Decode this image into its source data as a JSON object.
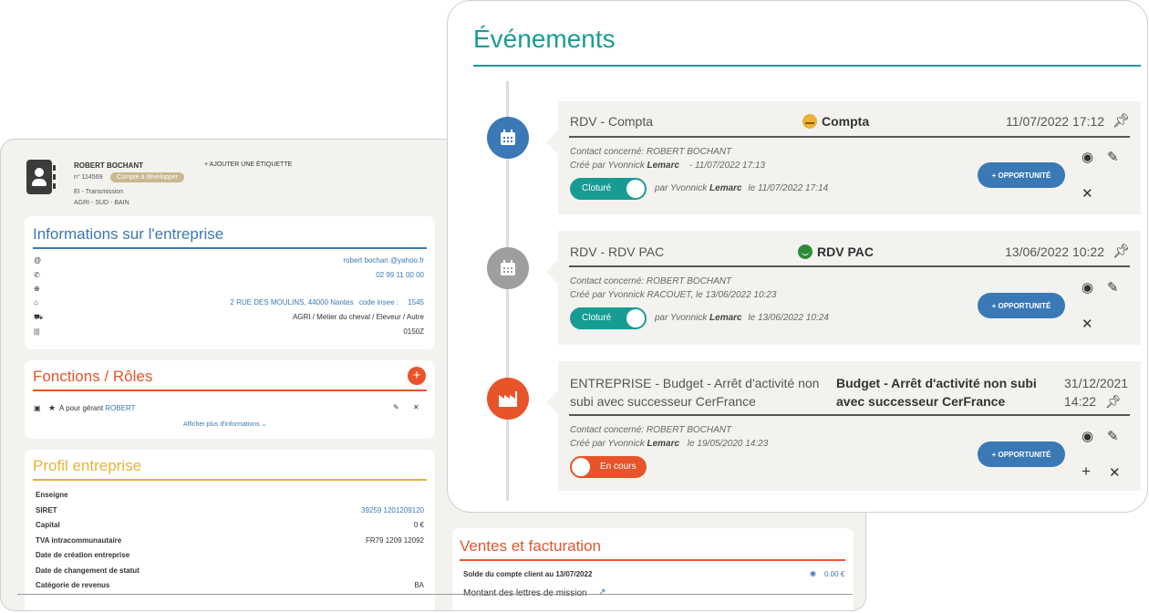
{
  "company": {
    "name": "ROBERT BOCHANT",
    "number": "n° 114569",
    "tag": "Compte à développer",
    "add_label": "+ AJOUTER UNE ÉTIQUETTE",
    "line1": "EI - Transmission",
    "line2": "AGRI - SUD - BAIN"
  },
  "info": {
    "title": "Informations sur l'entreprise",
    "email": "robert bochan @yahoo.fr",
    "phone": "02 99 11 00 00",
    "address": "2 RUE DES MOULINS, 44000 Nantes",
    "insee_label": "code insee :",
    "insee": "1545",
    "activity": "AGRI / Metier du cheval / Eleveur / Autre",
    "naf": "0150Z"
  },
  "roles": {
    "title": "Fonctions / Rôles",
    "item_prefix": "A pour gérant",
    "item_name": "ROBERT",
    "more": "Afficher plus d'informations"
  },
  "profile": {
    "title": "Profil entreprise",
    "rows": [
      {
        "label": "Enseigne",
        "value": ""
      },
      {
        "label": "SIRET",
        "value": "39259 1201209120"
      },
      {
        "label": "Capital",
        "value": "0 €"
      },
      {
        "label": "TVA intracommunautaire",
        "value": "FR79 1209 12092"
      },
      {
        "label": "Date de création entreprise",
        "value": ""
      },
      {
        "label": "Date de changement de statut",
        "value": ""
      },
      {
        "label": "Catégorie de revenus",
        "value": "BA"
      }
    ]
  },
  "sales": {
    "title": "Ventes et facturation",
    "balance_label": "Solde du compte client au 13/07/2022",
    "balance_value": "0.00 €",
    "missions": "Montant des lettres de mission"
  },
  "events": {
    "title": "Événements",
    "opp_label": "+ OPPORTUNITÉ",
    "items": [
      {
        "title": "RDV - Compta",
        "tag": "Compta",
        "date": "11/07/2022 17:12",
        "contact": "Contact concerné: ROBERT BOCHANT",
        "created_prefix": "Créé par Yvonnick",
        "created_name": "Lemarc",
        "created_suffix": "- 11/07/2022 17:13",
        "status": "Cloturé",
        "by_prefix": "par Yvonnick",
        "by_name": "Lemarc",
        "by_suffix": "le 11/07/2022 17:14"
      },
      {
        "title": "RDV - RDV PAC",
        "tag": "RDV PAC",
        "date": "13/06/2022 10:22",
        "contact": "Contact concerné: ROBERT BOCHANT",
        "created": "Créé par Yvonnick RACOUET, le 13/06/2022 10:23",
        "status": "Cloturé",
        "by_prefix": "par Yvonnick",
        "by_name": "Lemarc",
        "by_suffix": "le 13/06/2022 10:24"
      },
      {
        "title_line1": "ENTREPRISE - Budget - Arrêt d'activité non",
        "title_line2": "subi avec successeur CerFrance",
        "tag_line1": "Budget - Arrêt d'activité non subi",
        "tag_line2": "avec successeur CerFrance",
        "date_line1": "31/12/2021",
        "date_line2": "14:22",
        "contact": "Contact concerné: ROBERT BOCHANT",
        "created_prefix": "Créé par Yvonnick",
        "created_name": "Lemarc",
        "created_suffix": "le 19/05/2020 14:23",
        "status": "En cours"
      }
    ]
  },
  "colors": {
    "teal": "#179c94",
    "blue": "#3a79b5",
    "orange": "#e8542a",
    "gold": "#e8b33a"
  }
}
